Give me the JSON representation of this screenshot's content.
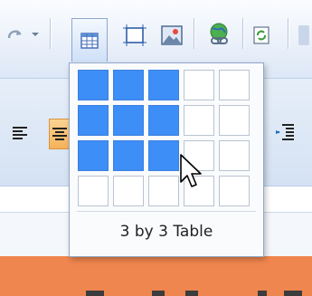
{
  "dropdown": {
    "caption": "3 by 3 Table",
    "grid_rows": 4,
    "grid_cols": 5,
    "selected_rows": 3,
    "selected_cols": 3
  },
  "toolbar": {
    "icons": [
      "redo-icon",
      "dropdown-arrow-icon",
      "insert-table-icon",
      "insert-frame-icon",
      "insert-image-icon",
      "insert-link-icon",
      "refresh-icon"
    ]
  },
  "format_toolbar": {
    "icons": [
      "align-left-icon",
      "align-center-icon",
      "indent-icon"
    ],
    "accent": "#f6b25a"
  },
  "colors": {
    "selection": "#3d8ef6",
    "band": "#f0864f"
  }
}
